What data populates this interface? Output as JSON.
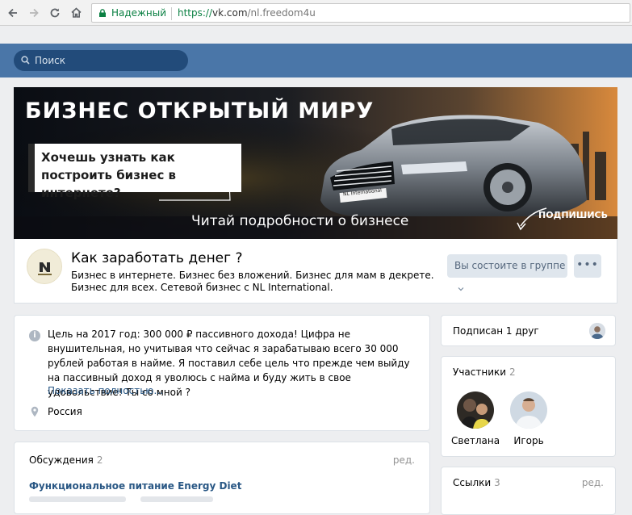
{
  "browser": {
    "secure_label": "Надежный",
    "url_scheme": "https://",
    "url_host": "vk.com",
    "url_path": "/nl.freedom4u"
  },
  "vk": {
    "search_placeholder": "Поиск"
  },
  "cover": {
    "title": "БИЗНЕС ОТКРЫТЫЙ МИРУ",
    "question": "Хочешь узнать как построить бизнес в интернете?",
    "cta": "Читай подробности о бизнесе",
    "subscribe": "ПОДПИШИСЬ",
    "plate": "NL International"
  },
  "group": {
    "title": "Как заработать денег ?",
    "description": "Бизнес в интернете. Бизнес без вложений. Бизнес для мам в декрете. Бизнес для всех. Сетевой бизнес с NL International.",
    "member_button": "Вы состоите в группе",
    "more_button": "•••"
  },
  "info": {
    "text": "Цель на 2017 год: 300 000 ₽ пассивного дохода! Цифра не внушительная, но учитывая что сейчас я зарабатываю всего 30 000 рублей работая в найме. Я поставил себе цель что прежде чем выйду на пассивный доход я уволюсь с найма и буду жить в свое удовольствие! Ты со мной ?",
    "show_more": "Показать полностью…",
    "location": "Россия"
  },
  "discussions": {
    "title": "Обсуждения",
    "count": "2",
    "edit": "ред.",
    "topic": "Функциональное питание Energy Diet"
  },
  "sidebar": {
    "subscribed": "Подписан 1 друг",
    "members_title": "Участники",
    "members_count": "2",
    "members": [
      {
        "name": "Светлана"
      },
      {
        "name": "Игорь"
      }
    ],
    "links_title": "Ссылки",
    "links_count": "3",
    "links_edit": "ред."
  },
  "colors": {
    "vk_blue": "#4a76a8",
    "link": "#2a5885",
    "secure_green": "#0b8043"
  }
}
